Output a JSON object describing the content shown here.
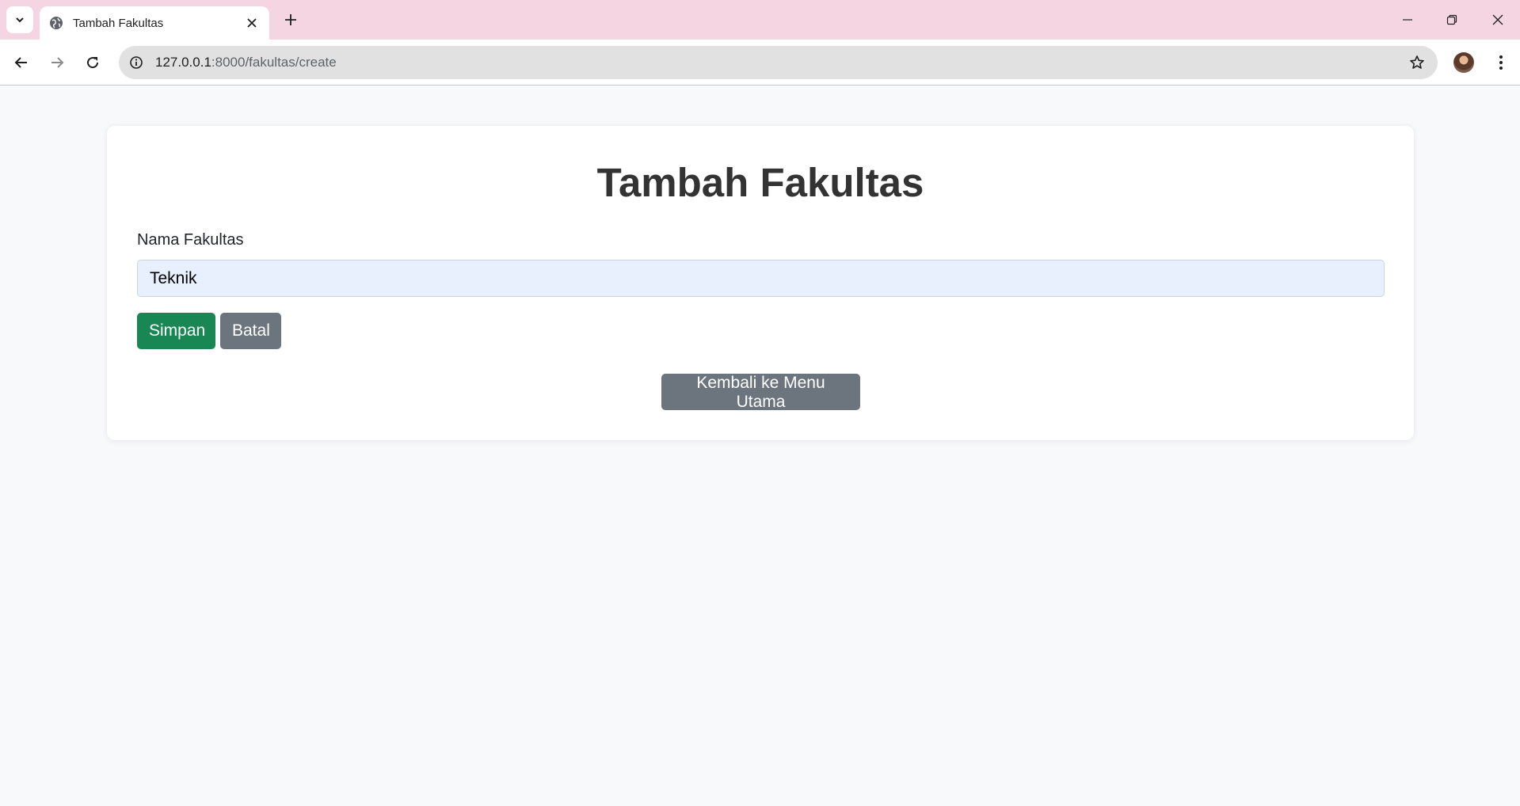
{
  "browser": {
    "tab_title": "Tambah Fakultas",
    "url_host": "127.0.0.1",
    "url_path": ":8000/fakultas/create"
  },
  "page": {
    "title": "Tambah Fakultas",
    "field_label": "Nama Fakultas",
    "field_value": "Teknik",
    "save_label": "Simpan",
    "cancel_label": "Batal",
    "home_label": "Kembali ke Menu Utama"
  },
  "colors": {
    "tabstrip": "#f6d5e3",
    "page_bg": "#f8f9fb",
    "input_bg": "#e8f0fe",
    "save_button": "#198754",
    "secondary_button": "#6c757d",
    "title_text": "#333333"
  },
  "icons": {
    "tab_search": "chevron-down-icon",
    "favicon": "globe-icon",
    "tab_close": "close-icon",
    "new_tab": "plus-icon",
    "back": "arrow-left-icon",
    "forward": "arrow-right-icon",
    "reload": "reload-icon",
    "site_info": "info-icon",
    "bookmark": "star-icon",
    "menu": "kebab-menu-icon"
  }
}
